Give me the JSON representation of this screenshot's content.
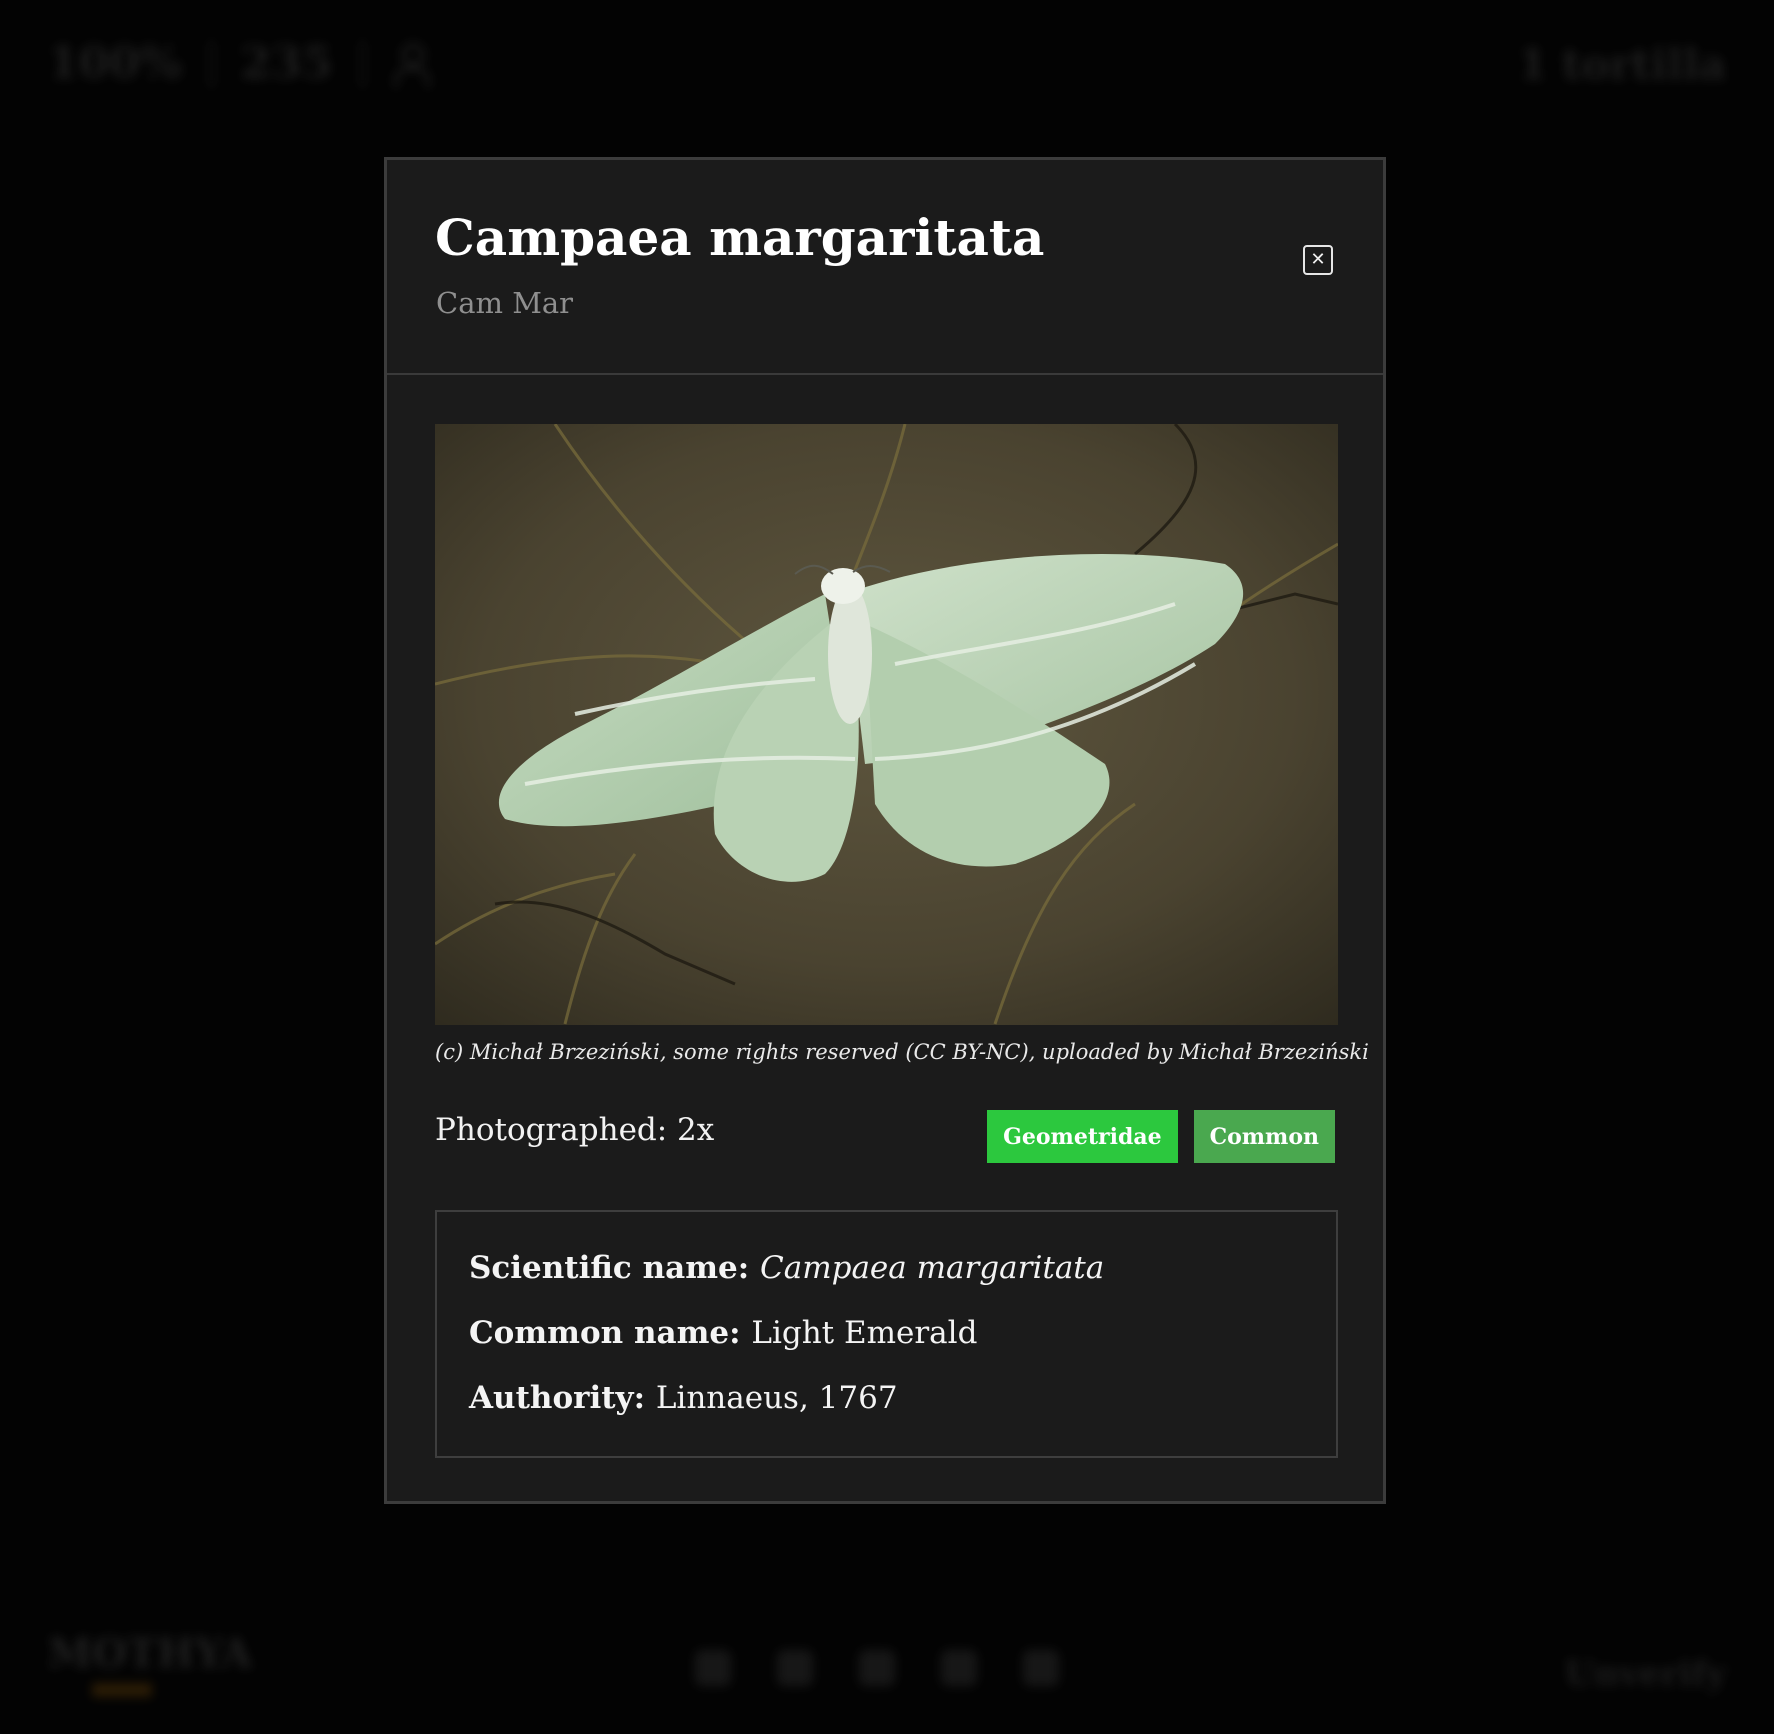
{
  "background": {
    "stats": [
      "100%",
      "235"
    ],
    "user_label": "1 tortilla",
    "logo_text": "MOTHYA",
    "right_label": "Unverify"
  },
  "modal": {
    "title": "Campaea margaritata",
    "subtitle": "Cam Mar",
    "close_icon": "close-icon",
    "photo_credit": "(c) Michał Brzeziński, some rights reserved (CC BY-NC), uploaded by Michał Brzeziński",
    "photographed_label": "Photographed: 2x",
    "tags": [
      {
        "label": "Geometridae",
        "color": "#2cc83e"
      },
      {
        "label": "Common",
        "color": "#4aa84f"
      }
    ],
    "info": {
      "scientific_label": "Scientific name:",
      "scientific_value": "Campaea margaritata",
      "common_label": "Common name:",
      "common_value": "Light Emerald",
      "authority_label": "Authority:",
      "authority_value": "Linnaeus, 1767"
    }
  },
  "colors": {
    "modal_background": "#1b1b1b",
    "tag_family": "#2cc83e",
    "tag_common": "#4aa84f"
  }
}
